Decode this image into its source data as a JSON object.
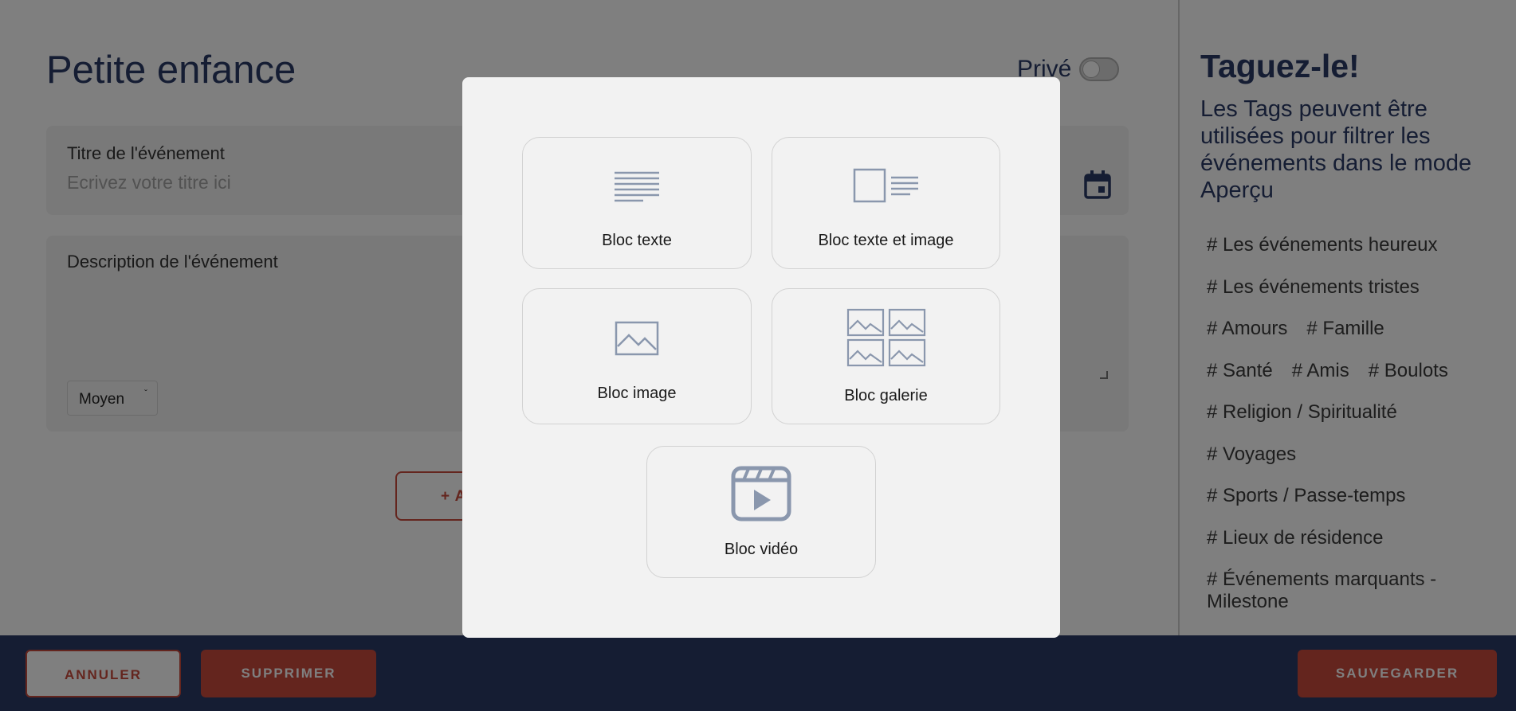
{
  "page": {
    "title": "Petite enfance",
    "private_label": "Privé"
  },
  "event_title": {
    "label": "Titre de l'événement",
    "placeholder": "Ecrivez votre titre ici"
  },
  "event_description": {
    "label": "Description de l'événement",
    "size_select": {
      "selected": "Moyen",
      "caret": "ˇ"
    }
  },
  "add_block_label": "+ A",
  "sidebar": {
    "title": "Taguez-le!",
    "description": "Les Tags peuvent être utilisées pour filtrer les événements dans le mode Aperçu",
    "tag_rows": [
      [
        "# Les événements heureux"
      ],
      [
        "# Les événements tristes"
      ],
      [
        "# Amours",
        "# Famille"
      ],
      [
        "# Santé",
        "# Amis",
        "# Boulots"
      ],
      [
        "# Religion / Spiritualité"
      ],
      [
        "# Voyages"
      ],
      [
        "# Sports / Passe-temps"
      ],
      [
        "# Lieux de résidence"
      ],
      [
        "# Événements marquants - Milestone"
      ]
    ]
  },
  "footer": {
    "cancel": "ANNULER",
    "delete": "SUPPRIMER",
    "save": "SAUVEGARDER"
  },
  "modal": {
    "blocks": [
      {
        "label": "Bloc texte",
        "icon": "text-lines-icon"
      },
      {
        "label": "Bloc texte et image",
        "icon": "text-image-icon"
      },
      {
        "label": "Bloc image",
        "icon": "image-icon"
      },
      {
        "label": "Bloc galerie",
        "icon": "gallery-icon"
      },
      {
        "label": "Bloc vidéo",
        "icon": "video-icon"
      }
    ]
  },
  "colors": {
    "primary_navy": "#2b3a67",
    "accent_red": "#c94a3d",
    "icon_gray": "#8a97ad"
  }
}
